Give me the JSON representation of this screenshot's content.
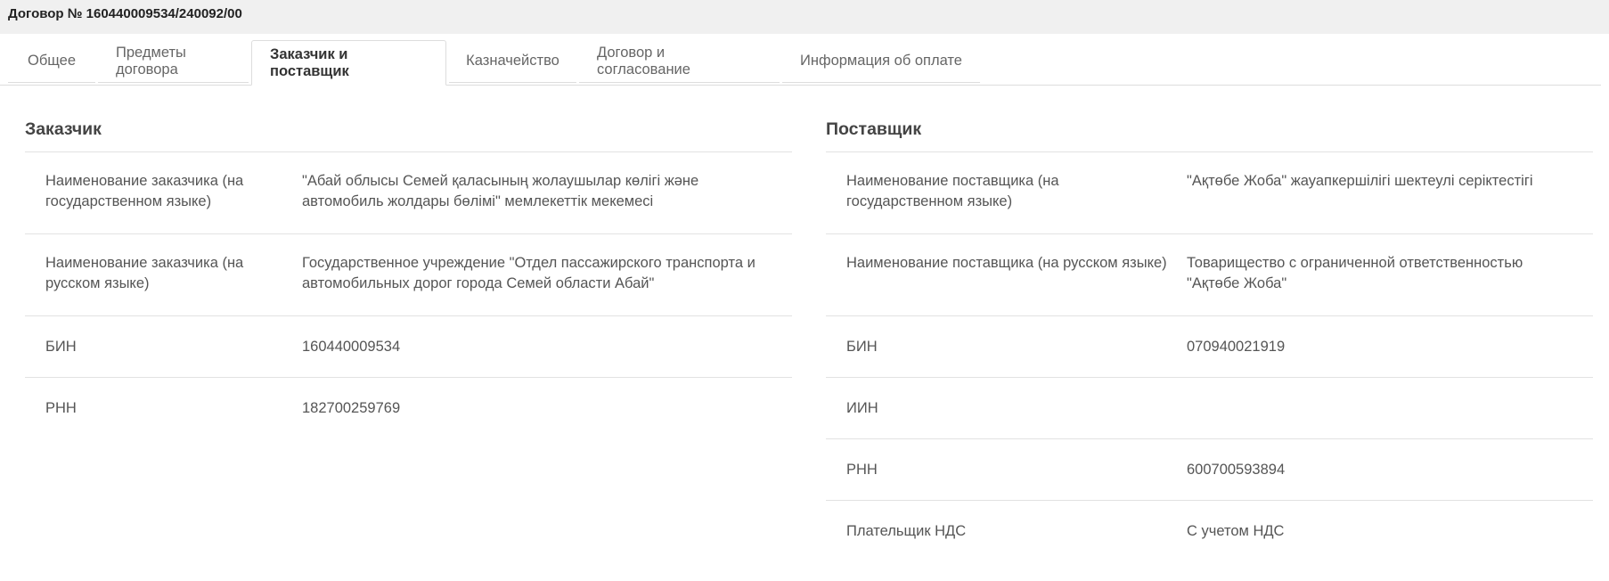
{
  "header": {
    "title": "Договор № 160440009534/240092/00"
  },
  "tabs": [
    {
      "label": "Общее",
      "active": false
    },
    {
      "label": "Предметы договора",
      "active": false
    },
    {
      "label": "Заказчик и поставщик",
      "active": true
    },
    {
      "label": "Казначейство",
      "active": false
    },
    {
      "label": "Договор и согласование",
      "active": false
    },
    {
      "label": "Информация об оплате",
      "active": false
    }
  ],
  "customer": {
    "title": "Заказчик",
    "rows": [
      {
        "label": "Наименование заказчика (на государственном языке)",
        "value": "\"Абай облысы Семей қаласының жолаушылар көлігі және автомобиль жолдары бөлімі\" мемлекеттік мекемесі"
      },
      {
        "label": "Наименование заказчика (на русском языке)",
        "value": "Государственное учреждение \"Отдел пассажирского транспорта и автомобильных дорог города Семей области Абай\""
      },
      {
        "label": "БИН",
        "value": "160440009534"
      },
      {
        "label": "РНН",
        "value": "182700259769"
      }
    ]
  },
  "supplier": {
    "title": "Поставщик",
    "rows": [
      {
        "label": "Наименование поставщика (на государственном языке)",
        "value": "\"Ақтөбе Жоба\" жауапкершілігі шектеулі серіктестігі"
      },
      {
        "label": "Наименование поставщика (на русском языке)",
        "value": "Товарищество с ограниченной ответственностью \"Ақтөбе Жоба\""
      },
      {
        "label": "БИН",
        "value": "070940021919"
      },
      {
        "label": "ИИН",
        "value": ""
      },
      {
        "label": "РНН",
        "value": "600700593894"
      },
      {
        "label": "Плательщик НДС",
        "value": "С учетом НДС"
      }
    ]
  }
}
